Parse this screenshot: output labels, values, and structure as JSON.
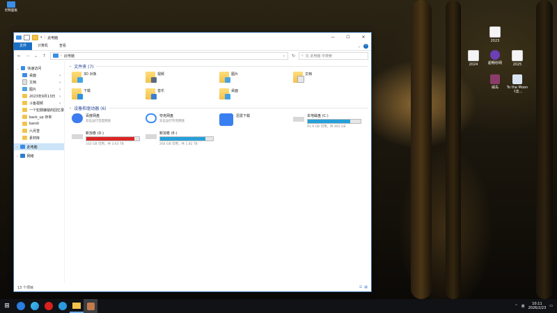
{
  "desktop": {
    "top_left_label": "控制面板",
    "icons": [
      {
        "label": "2023",
        "kind": "doc"
      },
      {
        "label": "2024",
        "kind": "doc"
      },
      {
        "label": "超畅秒网",
        "kind": "app"
      },
      {
        "label": "2025",
        "kind": "doc"
      },
      {
        "label": "威岛",
        "kind": "app"
      },
      {
        "label": "To the Moon《去...",
        "kind": "app"
      }
    ]
  },
  "window": {
    "title": "此电脑",
    "title_prefix": "| ",
    "controls": {
      "minimize": "—",
      "maximize": "☐",
      "close": "✕"
    },
    "ribbon": {
      "tabs": [
        "文件",
        "计算机",
        "查看"
      ],
      "help": "?"
    },
    "address": {
      "path": "此电脑",
      "search_placeholder": "在 此电脑 中搜索"
    },
    "nav": [
      {
        "label": "快速访问",
        "icon": "star-icon",
        "pinned": false,
        "selected": false
      },
      {
        "label": "桌面",
        "icon": "desktop-folder-icon",
        "pinned": true,
        "selected": false
      },
      {
        "label": "文档",
        "icon": "documents-folder-icon",
        "pinned": true,
        "selected": false
      },
      {
        "label": "图片",
        "icon": "pictures-folder-icon",
        "pinned": true,
        "selected": false
      },
      {
        "label": "2023年9月13日",
        "icon": "folder-icon",
        "pinned": true,
        "selected": false
      },
      {
        "label": "斗鱼视频",
        "icon": "folder-icon",
        "pinned": true,
        "selected": false
      },
      {
        "label": "一个犯罪嫌疑的回忆录",
        "icon": "folder-icon",
        "pinned": false,
        "selected": false
      },
      {
        "label": "back_up 存单",
        "icon": "folder-icon",
        "pinned": false,
        "selected": false
      },
      {
        "label": "bandi",
        "icon": "folder-icon",
        "pinned": false,
        "selected": false
      },
      {
        "label": "六月雪",
        "icon": "folder-icon",
        "pinned": false,
        "selected": false
      },
      {
        "label": "素材库",
        "icon": "folder-icon",
        "pinned": false,
        "selected": false
      },
      {
        "label": "此电脑",
        "icon": "computer-icon",
        "pinned": false,
        "selected": true
      },
      {
        "label": "网络",
        "icon": "network-icon",
        "pinned": false,
        "selected": false
      }
    ],
    "folders_group": "文件夹 (7)",
    "folders": [
      {
        "label": "3D 对象",
        "overlay": "#3fa6e8"
      },
      {
        "label": "视频",
        "overlay": "#5b6b7c"
      },
      {
        "label": "图片",
        "overlay": "#4da3e0"
      },
      {
        "label": "文档",
        "overlay": "#e8e8e8"
      },
      {
        "label": "下载",
        "overlay": "#2f8fe0"
      },
      {
        "label": "音乐",
        "overlay": "#3a7fd0"
      },
      {
        "label": "桌面",
        "overlay": "#3f9fe6"
      }
    ],
    "devices_group": "设备和驱动器 (6)",
    "devices": [
      {
        "name": "百度网盘",
        "sub": "双击运行百度网盘",
        "type": "app",
        "color": "#3d7cf0"
      },
      {
        "name": "夸克网盘",
        "sub": "双击运行夸克网盘",
        "type": "app",
        "color": "#3c8cf5"
      },
      {
        "name": "迅雷下载",
        "sub": "",
        "type": "app",
        "color": "#3a7ff0"
      },
      {
        "name": "本地磁盘 (C:)",
        "sub": "91.9 GB 可用，共 465 GB",
        "type": "drive",
        "fill": 0.8,
        "color": "#26a0da"
      },
      {
        "name": "新加卷 (D:)",
        "sub": "332 GB 可用，共 3.63 TB",
        "type": "drive",
        "fill": 0.91,
        "color": "#da2626"
      },
      {
        "name": "新加卷 (E:)",
        "sub": "264 GB 可用，共 1.81 TB",
        "type": "drive",
        "fill": 0.86,
        "color": "#26a0da"
      }
    ],
    "status": "13 个项目"
  },
  "taskbar": {
    "apps": [
      "start-icon",
      "search-app-icon",
      "edge-icon",
      "netease-music-icon",
      "app-q-icon",
      "file-explorer-icon",
      "app-active-icon"
    ],
    "ime": "英",
    "time": "10:11",
    "date": "2026/2/23"
  }
}
